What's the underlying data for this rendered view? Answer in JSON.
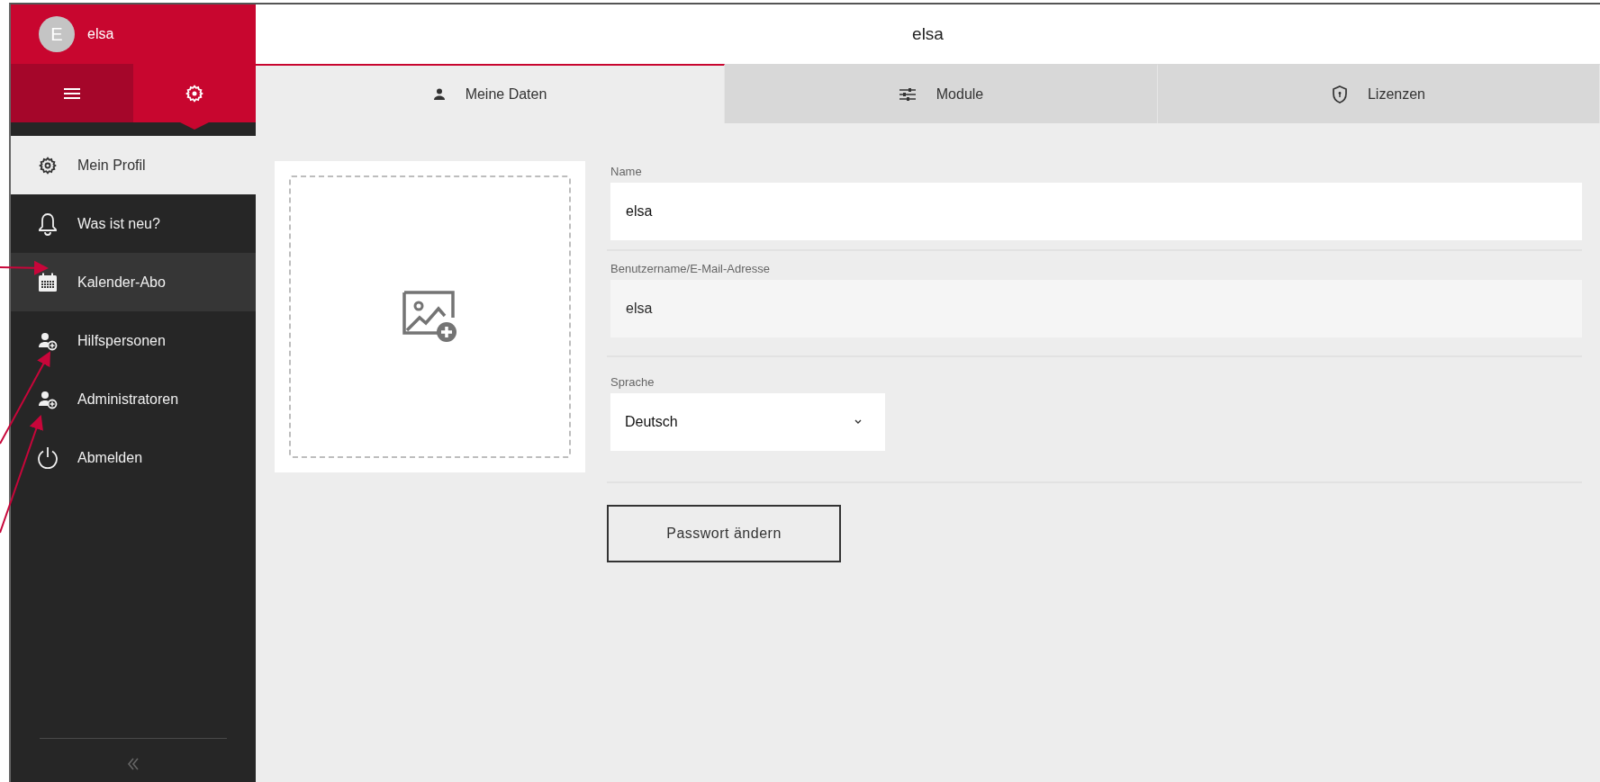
{
  "sidebar": {
    "user": {
      "initial": "E",
      "name": "elsa"
    },
    "toggles": [
      {
        "selected": false
      },
      {
        "selected": true
      }
    ],
    "items": [
      {
        "label": "Mein Profil",
        "selected": true,
        "hovered": false
      },
      {
        "label": "Was ist neu?",
        "selected": false,
        "hovered": false
      },
      {
        "label": "Kalender-Abo",
        "selected": false,
        "hovered": true
      },
      {
        "label": "Hilfspersonen",
        "selected": false,
        "hovered": false
      },
      {
        "label": "Administratoren",
        "selected": false,
        "hovered": false
      },
      {
        "label": "Abmelden",
        "selected": false,
        "hovered": false
      }
    ]
  },
  "header": {
    "title": "elsa"
  },
  "tabs": [
    {
      "label": "Meine Daten",
      "selected": true
    },
    {
      "label": "Module",
      "selected": false
    },
    {
      "label": "Lizenzen",
      "selected": false
    }
  ],
  "form": {
    "fields": [
      {
        "kind": "text",
        "label": "Name",
        "value": "elsa",
        "disabled": false
      },
      {
        "kind": "text",
        "label": "Benutzername/E-Mail-Adresse",
        "value": "elsa",
        "disabled": true
      },
      {
        "kind": "select",
        "label": "Sprache",
        "value": "Deutsch",
        "disabled": false
      }
    ],
    "button": "Passwort ändern"
  }
}
